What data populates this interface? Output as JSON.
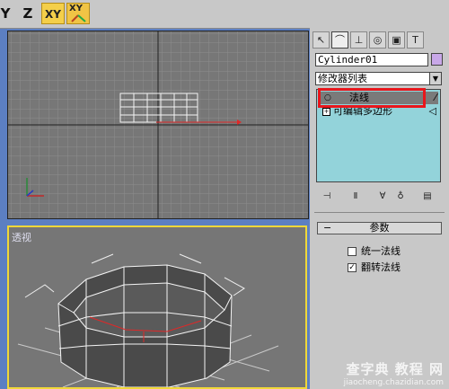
{
  "toolbar": {
    "items": [
      {
        "name": "y-axis-constraint",
        "label": "Y"
      },
      {
        "name": "z-axis-constraint",
        "label": "Z"
      },
      {
        "name": "xy-plane-constraint",
        "label": "XY"
      },
      {
        "name": "xy-plane-toggle",
        "label": "XY"
      }
    ]
  },
  "viewports": {
    "top": {
      "label": ""
    },
    "perspective": {
      "label": "透视"
    }
  },
  "command_panel": {
    "tabs": [
      {
        "name": "create-tab-icon"
      },
      {
        "name": "modify-tab-icon"
      },
      {
        "name": "hierarchy-tab-icon"
      },
      {
        "name": "motion-tab-icon"
      },
      {
        "name": "display-tab-icon"
      },
      {
        "name": "utilities-tab-icon"
      }
    ],
    "object_name": "Cylinder01",
    "object_color": "#c8a8e8",
    "modifier_list_label": "修改器列表",
    "stack": [
      {
        "label": "法线",
        "selected": true
      },
      {
        "label": "可编辑多边形",
        "selected": false
      }
    ],
    "highlight_color": "#e8161c",
    "stack_buttons": [
      "pin-stack-icon",
      "show-end-result-icon",
      "make-unique-icon",
      "remove-modifier-icon",
      "configure-sets-icon"
    ]
  },
  "params": {
    "title": "参数",
    "unify_normals": {
      "label": "统一法线",
      "checked": false
    },
    "flip_normals": {
      "label": "翻转法线",
      "checked": true
    }
  },
  "watermark": {
    "line1": "查字典 教程 网",
    "line2": "jiaocheng.chazidian.com"
  }
}
